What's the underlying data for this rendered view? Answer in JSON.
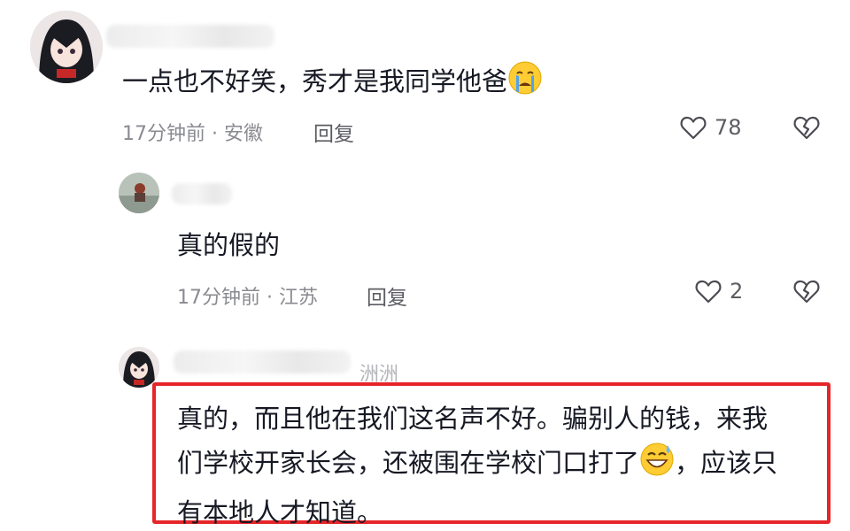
{
  "comments": [
    {
      "text": "一点也不好笑，秀才是我同学他爸",
      "emoji": "crying-face",
      "time": "17分钟前",
      "location": "安徽",
      "reply_label": "回复",
      "likes": "78"
    },
    {
      "text": "真的假的",
      "time": "17分钟前",
      "location": "江苏",
      "reply_label": "回复",
      "likes": "2"
    },
    {
      "username_suffix": "洲洲",
      "text_line1": "真的，而且他在我们这名声不好。骗别人的钱，来我",
      "text_line2a": "们学校开家长会，还被围在学校门口打了",
      "emoji": "grinning-sweat-face",
      "text_line2b": "，应该只",
      "text_line3": "有本地人才知道。"
    }
  ],
  "meta_separator": " · ",
  "colors": {
    "highlight_border": "#e5252a",
    "text": "#161823",
    "meta": "#8a8b91"
  }
}
